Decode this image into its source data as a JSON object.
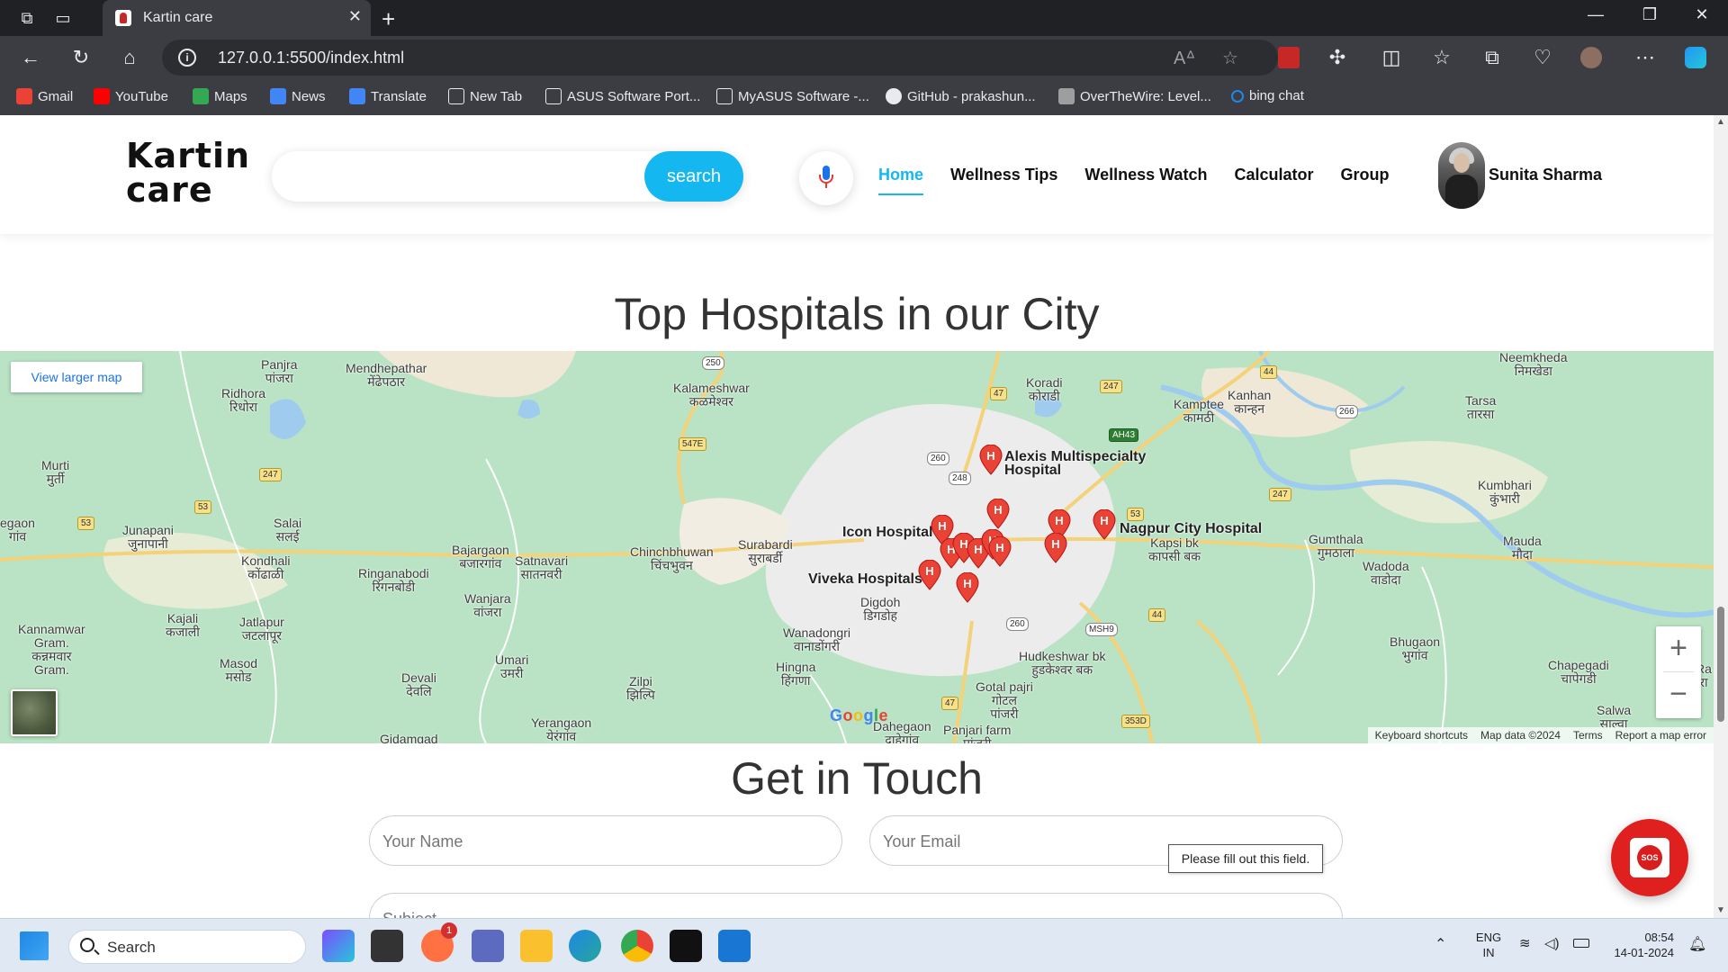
{
  "browser": {
    "tab_title": "Kartin care",
    "url": "127.0.0.1:5500/index.html",
    "bookmarks": [
      {
        "label": "Gmail",
        "color": "#ea4335"
      },
      {
        "label": "YouTube",
        "color": "#ff0000"
      },
      {
        "label": "Maps",
        "color": "#34a853"
      },
      {
        "label": "News",
        "color": "#4285f4"
      },
      {
        "label": "Translate",
        "color": "#4285f4"
      },
      {
        "label": "New Tab",
        "color": "#e8eaed"
      },
      {
        "label": "ASUS Software Port...",
        "color": "#e8eaed"
      },
      {
        "label": "MyASUS Software -...",
        "color": "#e8eaed"
      },
      {
        "label": "GitHub - prakashun...",
        "color": "#e8eaed"
      },
      {
        "label": "OverTheWire: Level...",
        "color": "#9e9e9e"
      },
      {
        "label": "bing chat",
        "color": "#1e88e5"
      }
    ]
  },
  "header": {
    "logo_line1": "Kartin",
    "logo_line2": "care",
    "search_placeholder": "",
    "search_button": "search",
    "nav": [
      "Home",
      "Wellness Tips",
      "Wellness Watch",
      "Calculator",
      "Group"
    ],
    "active_nav": "Home",
    "user_name": "Sunita Sharma"
  },
  "hospitals": {
    "title": "Top Hospitals in our City",
    "view_larger_map": "View larger map",
    "hospital_labels": [
      "Alexis Multispecialty\nHospital",
      "Icon Hospital",
      "Nagpur City Hospital",
      "Viveka Hospitals"
    ],
    "places": [
      "Panjra\nपांजरा",
      "Mendhepathar\nमेंढेपठार",
      "Ridhora\nरिधोरा",
      "Kalameshwar\nकळमेश्वर",
      "Koradi\nकोराडी",
      "Kamptee\nकामठी",
      "Kanhan\nकान्हन",
      "Tarsa\nतारसा",
      "Murti\nमुर्ती",
      "Salai\nसलई",
      "Junapani\nजुनापानी",
      "Kondhali\nकोंढाळी",
      "Bajargaon\nबजारगांव",
      "Satnavari\nसातनवरी",
      "Ringanabodi\nरिंगनबोडी",
      "Chinchbhuwan\nचिंचभुवन",
      "Surabardi\nसुराबर्डी",
      "Kapsi bk\nकापसी बक",
      "Gumthala\nगुमठाला",
      "Mauda\nमौदा",
      "Wadoda\nवाडोदा",
      "Kumbhari\nकुंभारी",
      "Kajali\nकजाली",
      "Jatlapur\nजटलापूर",
      "Wanjara\nवांजरा",
      "Digdoh\nडिगडोह",
      "Wanadongri\nवानाडोंगरी",
      "Hingna\nहिंगणा",
      "Kannamwar\nGram.\nकन्नमवार\nGram.",
      "Masod\nमसोड",
      "Devali\nदेवलि",
      "Umari\nउमरी",
      "Zilpi\nझिल्पि",
      "Yerangaon\nयेरंगांव",
      "Hudkeshwar bk\nहुडकेश्वर बक",
      "Gotal pajri\nगोटल\nपांजरी",
      "Dahegaon\nदाहेगांव",
      "Panjari farm\nपांजरी",
      "Bhugaon\nभुगांव",
      "Chapegadi\nचापेगडी",
      "Salwa\nसाल्वा",
      "Gidamgad",
      "Neemkheda\nनिमखेडा",
      "egaon\nगांव",
      "Ra\nरा"
    ],
    "road_shields": [
      "250",
      "247",
      "47",
      "44",
      "AH43",
      "266",
      "547E",
      "260",
      "248",
      "247",
      "53",
      "53",
      "53",
      "44",
      "260",
      "MSH9",
      "47",
      "353D",
      "247"
    ],
    "google_logo": "Google",
    "footer_links": [
      "Keyboard shortcuts",
      "Map data ©2024",
      "Terms",
      "Report a map error"
    ],
    "zoom_in": "+",
    "zoom_out": "−"
  },
  "contact": {
    "title": "Get in Touch",
    "name_placeholder": "Your Name",
    "email_placeholder": "Your Email",
    "subject_placeholder": "Subject",
    "validation_tooltip": "Please fill out this field."
  },
  "sos": {
    "label": "SOS"
  },
  "taskbar": {
    "search_label": "Search",
    "badge_count": "1",
    "lang_line1": "ENG",
    "lang_line2": "IN",
    "time": "08:54",
    "date": "14-01-2024"
  }
}
